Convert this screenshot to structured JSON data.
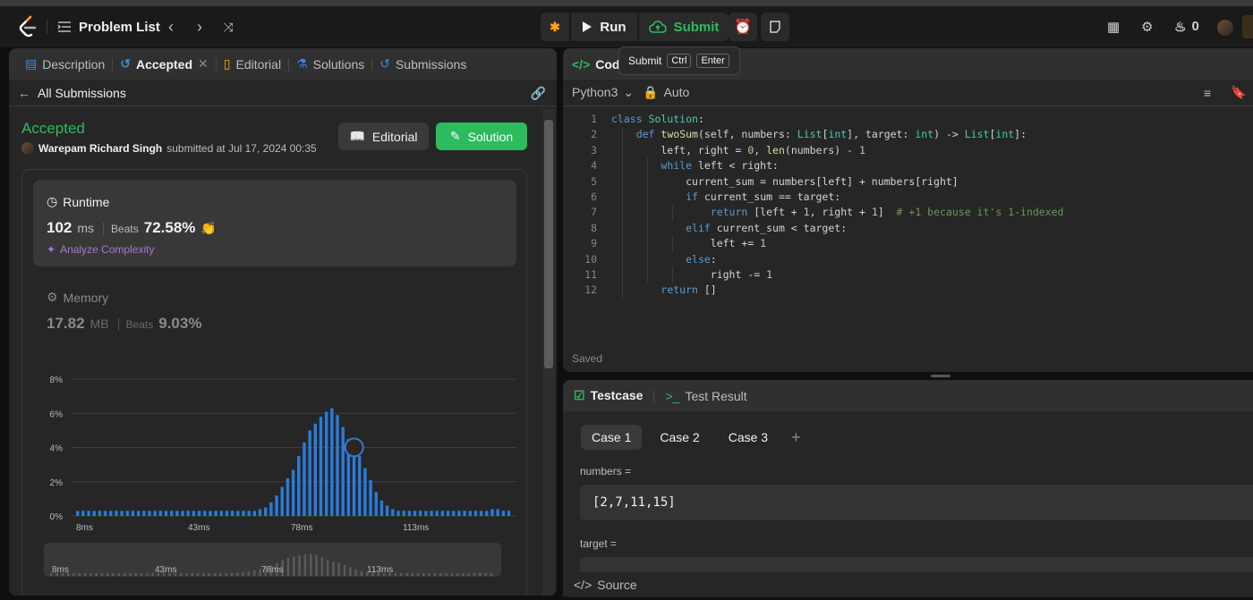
{
  "navbar": {
    "problem_list": "Problem List",
    "run": "Run",
    "submit": "Submit",
    "streak": "0"
  },
  "tooltip": {
    "label": "Submit",
    "key1": "Ctrl",
    "key2": "Enter"
  },
  "left_tabs": [
    {
      "label": "Description"
    },
    {
      "label": "Accepted"
    },
    {
      "label": "Editorial"
    },
    {
      "label": "Solutions"
    },
    {
      "label": "Submissions"
    }
  ],
  "subbar": {
    "back": "All Submissions"
  },
  "submission": {
    "status": "Accepted",
    "user": "Warepam Richard Singh",
    "submitted_at": "submitted at Jul 17, 2024 00:35",
    "editorial_btn": "Editorial",
    "solution_btn": "Solution"
  },
  "runtime": {
    "title": "Runtime",
    "value": "102",
    "unit": "ms",
    "beats_label": "Beats",
    "beats": "72.58%",
    "analyze": "Analyze Complexity"
  },
  "memory": {
    "title": "Memory",
    "value": "17.82",
    "unit": "MB",
    "beats_label": "Beats",
    "beats": "9.03%"
  },
  "chart_data": {
    "type": "bar",
    "yticks": [
      "8%",
      "6%",
      "4%",
      "2%",
      "0%"
    ],
    "ylim": [
      0,
      8
    ],
    "xticks": [
      "8ms",
      "43ms",
      "78ms",
      "113ms"
    ],
    "values": [
      0.3,
      0.3,
      0.3,
      0.3,
      0.3,
      0.3,
      0.3,
      0.3,
      0.3,
      0.3,
      0.3,
      0.3,
      0.3,
      0.3,
      0.3,
      0.3,
      0.3,
      0.3,
      0.3,
      0.3,
      0.3,
      0.3,
      0.3,
      0.3,
      0.3,
      0.3,
      0.3,
      0.3,
      0.3,
      0.3,
      0.3,
      0.3,
      0.3,
      0.4,
      0.5,
      0.8,
      1.2,
      1.7,
      2.2,
      2.7,
      3.5,
      4.3,
      5.0,
      5.4,
      5.8,
      6.1,
      6.3,
      5.9,
      5.2,
      4.5,
      3.9,
      3.5,
      2.8,
      2.1,
      1.4,
      0.9,
      0.6,
      0.4,
      0.3,
      0.3,
      0.3,
      0.3,
      0.3,
      0.3,
      0.3,
      0.3,
      0.3,
      0.3,
      0.3,
      0.3,
      0.3,
      0.3,
      0.3,
      0.3,
      0.3,
      0.4,
      0.4,
      0.3,
      0.3
    ],
    "highlight_index": 50
  },
  "code": {
    "tab": "Code",
    "language": "Python3",
    "mode": "Auto",
    "saved": "Saved",
    "line_numbers": [
      "1",
      "2",
      "3",
      "4",
      "5",
      "6",
      "7",
      "8",
      "9",
      "10",
      "11",
      "12"
    ]
  },
  "testcase": {
    "tab": "Testcase",
    "result_tab": "Test Result",
    "cases": [
      "Case 1",
      "Case 2",
      "Case 3"
    ],
    "numbers_label": "numbers =",
    "numbers_value": "[2,7,11,15]",
    "target_label": "target ="
  },
  "source": "Source"
}
